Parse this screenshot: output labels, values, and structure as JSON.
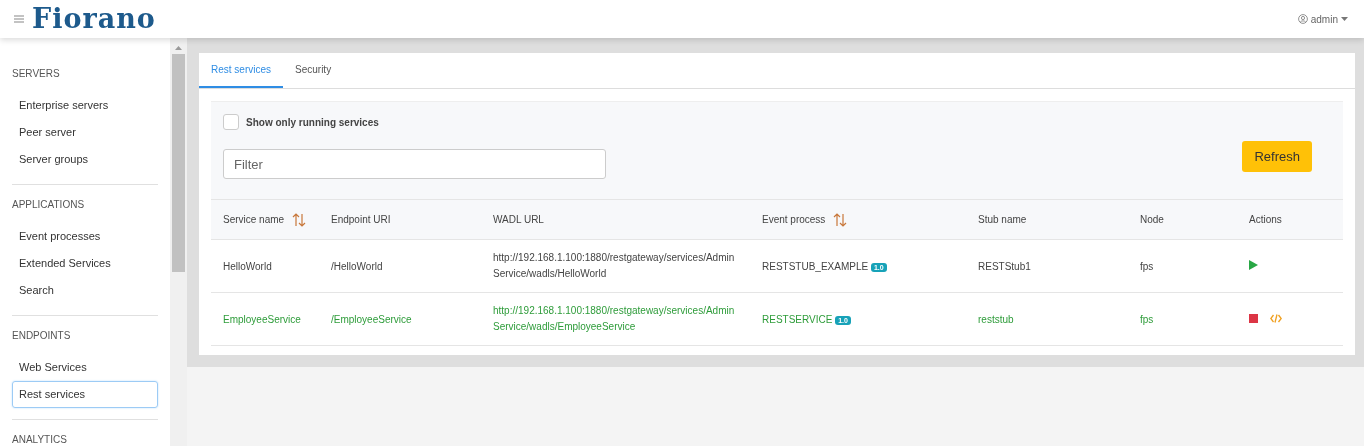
{
  "header": {
    "logo": "Fiorano",
    "user": "admin"
  },
  "sidebar": {
    "sections": [
      {
        "title": "SERVERS",
        "items": [
          {
            "label": "Enterprise servers",
            "selected": false
          },
          {
            "label": "Peer server",
            "selected": false
          },
          {
            "label": "Server groups",
            "selected": false
          }
        ]
      },
      {
        "title": "APPLICATIONS",
        "items": [
          {
            "label": "Event processes",
            "selected": false
          },
          {
            "label": "Extended Services",
            "selected": false
          },
          {
            "label": "Search",
            "selected": false
          }
        ]
      },
      {
        "title": "ENDPOINTS",
        "items": [
          {
            "label": "Web Services",
            "selected": false
          },
          {
            "label": "Rest services",
            "selected": true
          }
        ]
      },
      {
        "title": "ANALYTICS"
      }
    ]
  },
  "tabs": [
    {
      "label": "Rest services",
      "selected": true
    },
    {
      "label": "Security",
      "selected": false
    }
  ],
  "filter_panel": {
    "checkbox": {
      "label": "Show only running services",
      "checked": false
    },
    "search": {
      "placeholder": "Filter"
    },
    "refresh_button": "Refresh"
  },
  "table": {
    "columns": [
      {
        "label": "Service name",
        "sortable": true
      },
      {
        "label": "Endpoint URI",
        "sortable": false
      },
      {
        "label": "WADL URL",
        "sortable": false
      },
      {
        "label": "Event process",
        "sortable": true
      },
      {
        "label": "Stub name",
        "sortable": false
      },
      {
        "label": "Node",
        "sortable": false
      },
      {
        "label": "Actions",
        "sortable": false
      }
    ],
    "rows": [
      {
        "service_name": "HelloWorld",
        "endpoint_uri": "/HelloWorld",
        "wadl_url": "http://192.168.1.100:1880/restgateway/services/AdminService/wadls/HelloWorld",
        "event_process": "RESTSTUB_EXAMPLE",
        "version": "1.0",
        "stub_name": "RESTStub1",
        "node": "fps",
        "running": false
      },
      {
        "service_name": "EmployeeService",
        "endpoint_uri": "/EmployeeService",
        "wadl_url": "http://192.168.1.100:1880/restgateway/services/AdminService/wadls/EmployeeService",
        "event_process": "RESTSERVICE",
        "version": "1.0",
        "stub_name": "reststub",
        "node": "fps",
        "running": true
      }
    ]
  }
}
